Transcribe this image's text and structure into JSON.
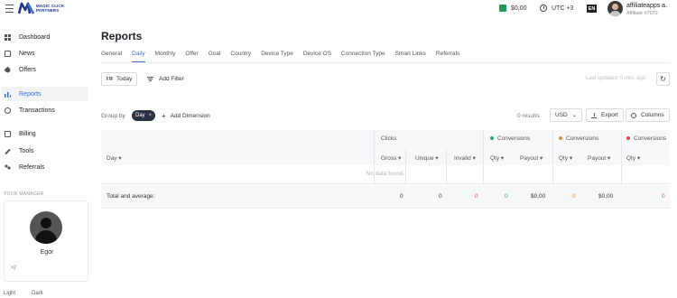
{
  "header": {
    "logo_text_line1": "MAGIC CLICK",
    "logo_text_line2": "PARTNERS",
    "balance": "$0,00",
    "timezone": "UTC +3",
    "language": "EN",
    "user_name": "affiliateapps a.",
    "user_id": "Affiliate #7072"
  },
  "sidebar": {
    "items": [
      {
        "label": "Dashboard",
        "icon": "dashboard-icon"
      },
      {
        "label": "News",
        "icon": "news-icon"
      },
      {
        "label": "Offers",
        "icon": "tag-icon"
      },
      {
        "label": "Reports",
        "icon": "bar-chart-icon",
        "active": true
      },
      {
        "label": "Transactions",
        "icon": "globe-icon"
      },
      {
        "label": "Billing",
        "icon": "billing-icon"
      },
      {
        "label": "Tools",
        "icon": "wrench-icon"
      },
      {
        "label": "Referrals",
        "icon": "referrals-icon"
      }
    ],
    "manager_label": "YOUR MANAGER",
    "manager_name": "Egor",
    "theme_light": "Light",
    "theme_dark": "Dark"
  },
  "main": {
    "title": "Reports",
    "tabs": [
      "General",
      "Daily",
      "Monthly",
      "Offer",
      "Goal",
      "Country",
      "Device Type",
      "Device OS",
      "Connection Type",
      "Smart Links",
      "Referrals"
    ],
    "active_tab": "Daily",
    "today_label": "Today",
    "add_filter_label": "Add Filter",
    "last_updated": "Last updated: 0 min. ago",
    "group_by_label": "Group by",
    "group_chip": "Day",
    "add_dimension_label": "Add Dimension",
    "results_label": "0 results",
    "currency": "USD",
    "export_label": "Export",
    "columns_label": "Columns"
  },
  "table": {
    "day_header": "Day",
    "clicks_header": "Clicks",
    "conv_header": "Conversions",
    "subheaders": [
      "Gross",
      "Unique",
      "Invalid",
      "Qty",
      "Payout",
      "Qty",
      "Payout",
      "Qty"
    ],
    "no_data": "No data found.",
    "total_label": "Total and average:",
    "totals": [
      "0",
      "0",
      "0",
      "0",
      "$0,00",
      "0",
      "$0,00",
      "0"
    ],
    "colors": {
      "green": "#2aa56a",
      "orange": "#e58a3a",
      "red": "#e0464b",
      "accent": "#3b6fd1"
    }
  }
}
